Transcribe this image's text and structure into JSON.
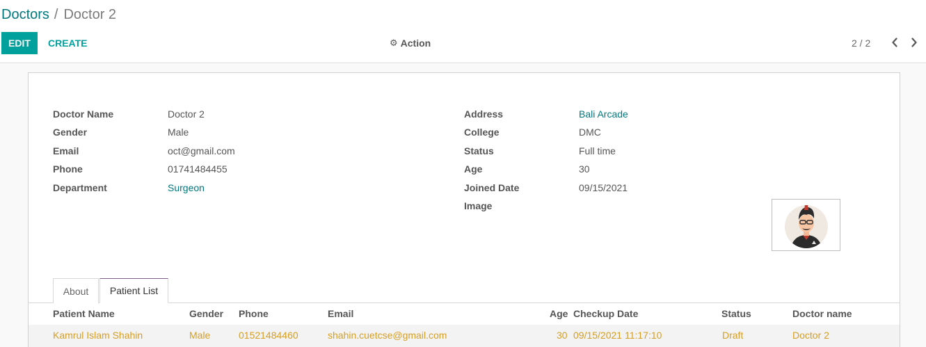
{
  "breadcrumb": {
    "parent": "Doctors",
    "separator": "/",
    "current": "Doctor 2"
  },
  "toolbar": {
    "edit_label": "EDIT",
    "create_label": "CREATE",
    "action_label": "Action",
    "action_icon": "gear-icon"
  },
  "pager": {
    "value": "2 / 2",
    "prev_icon": "chevron-left-icon",
    "next_icon": "chevron-right-icon"
  },
  "form": {
    "left": [
      {
        "label": "Doctor Name",
        "value": "Doctor 2",
        "link": false
      },
      {
        "label": "Gender",
        "value": "Male",
        "link": false
      },
      {
        "label": "Email",
        "value": "oct@gmail.com",
        "link": false
      },
      {
        "label": "Phone",
        "value": "01741484455",
        "link": false
      },
      {
        "label": "Department",
        "value": "Surgeon",
        "link": true
      }
    ],
    "right": [
      {
        "label": "Address",
        "value": "Bali Arcade",
        "link": true
      },
      {
        "label": "College",
        "value": "DMC",
        "link": false
      },
      {
        "label": "Status",
        "value": "Full time",
        "link": false
      },
      {
        "label": "Age",
        "value": "30",
        "link": false
      },
      {
        "label": "Joined Date",
        "value": "09/15/2021",
        "link": false
      },
      {
        "label": "Image",
        "value": "",
        "link": false
      }
    ]
  },
  "tabs": [
    {
      "label": "About",
      "active": false
    },
    {
      "label": "Patient List",
      "active": true
    }
  ],
  "patients": {
    "columns": [
      "Patient Name",
      "Gender",
      "Phone",
      "Email",
      "Age",
      "Checkup Date",
      "Status",
      "Doctor name"
    ],
    "rows": [
      [
        "Kamrul Islam Shahin",
        "Male",
        "01521484460",
        "shahin.cuetcse@gmail.com",
        "30",
        "09/15/2021 11:17:10",
        "Draft",
        "Doctor 2"
      ]
    ]
  },
  "colors": {
    "primary": "#00a09d",
    "link": "#00787f",
    "row_text": "#d69e25",
    "tab_accent": "#7c5a8a"
  }
}
